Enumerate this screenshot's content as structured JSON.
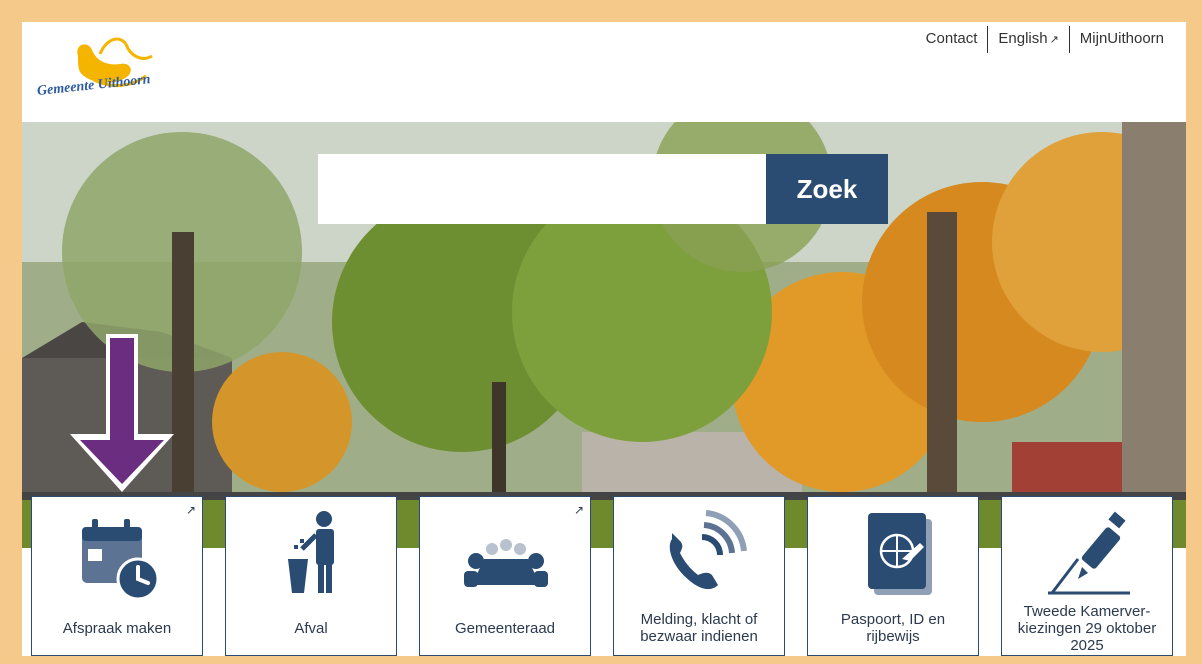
{
  "header": {
    "logo_text": "Gemeente Uithoorn",
    "links": [
      {
        "label": "Contact",
        "external": false
      },
      {
        "label": "English",
        "external": true
      },
      {
        "label": "MijnUithoorn",
        "external": false
      }
    ],
    "external_icon": "external-link-icon"
  },
  "search": {
    "placeholder": "",
    "value": "",
    "button_label": "Zoek"
  },
  "tiles": [
    {
      "label": "Afspraak maken",
      "icon": "calendar-clock-icon",
      "external": true
    },
    {
      "label": "Afval",
      "icon": "trash-person-icon",
      "external": false
    },
    {
      "label": "Gemeenteraad",
      "icon": "meeting-table-icon",
      "external": true
    },
    {
      "label": "Melding, klacht of bezwaar indienen",
      "icon": "phone-icon",
      "external": false
    },
    {
      "label": "Paspoort, ID en rijbewijs",
      "icon": "passport-icon",
      "external": false
    },
    {
      "label": "Tweede Kamerver-kiezingen 29 oktober 2025",
      "icon": "ballot-pencil-icon",
      "external": false
    }
  ],
  "colors": {
    "frame": "#f5c98a",
    "brand_blue": "#2a4b72",
    "arrow": "#6b2d80",
    "logo_yellow": "#f4b400"
  }
}
